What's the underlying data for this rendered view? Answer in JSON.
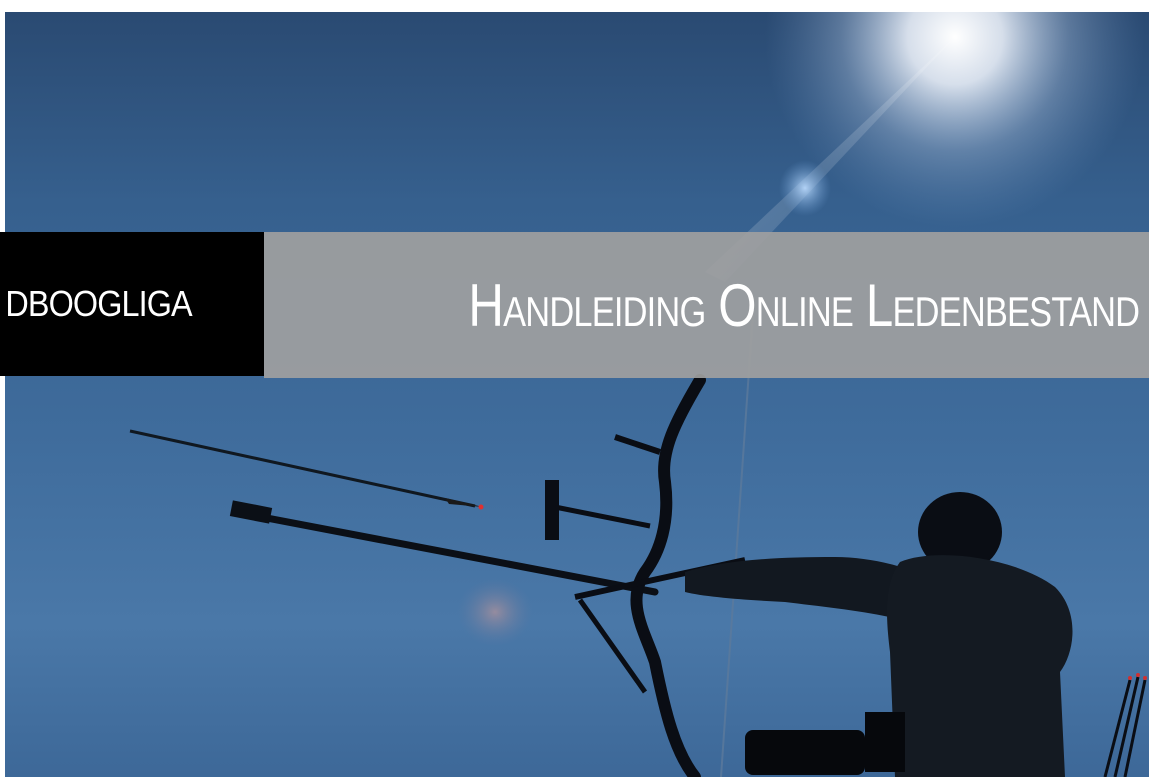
{
  "cover": {
    "brand": "DBOOGLIGA",
    "title": "Handleiding Online Ledenbestand"
  },
  "colors": {
    "band_left": "#000000",
    "band_right": "#a0a0a0",
    "text": "#ffffff",
    "sky": "#3f6c9c"
  }
}
